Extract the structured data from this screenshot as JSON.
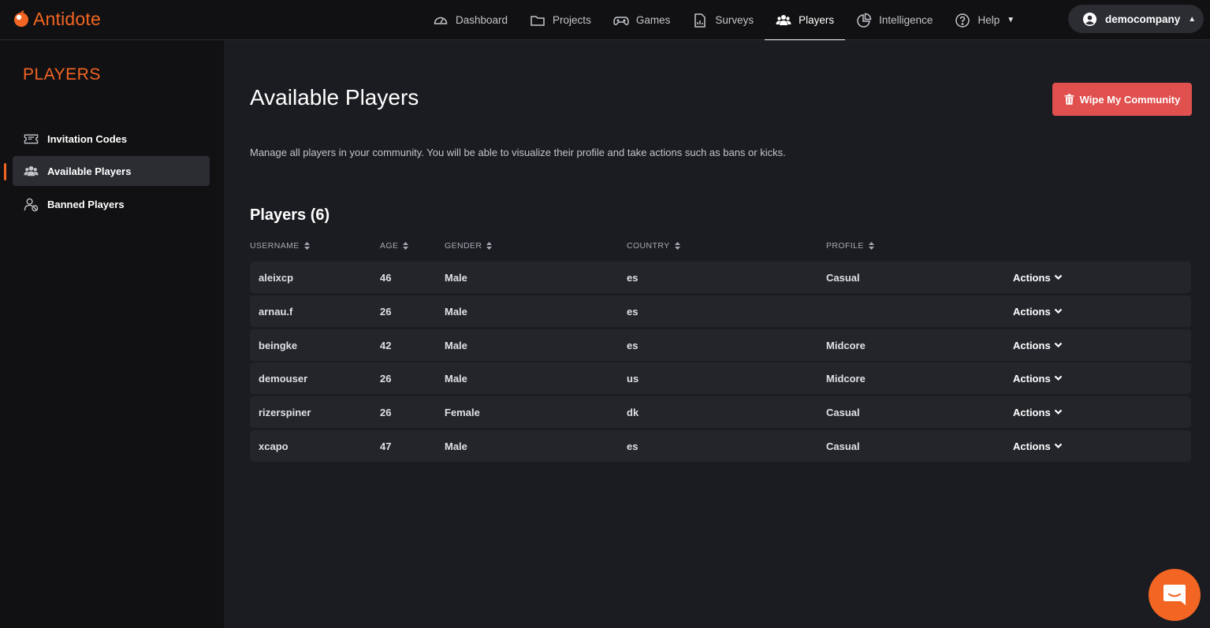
{
  "brand": {
    "name": "Antidote",
    "accent": "#f26522"
  },
  "nav": {
    "items": [
      {
        "label": "Dashboard",
        "icon": "gauge-icon"
      },
      {
        "label": "Projects",
        "icon": "folder-icon"
      },
      {
        "label": "Games",
        "icon": "gamepad-icon"
      },
      {
        "label": "Surveys",
        "icon": "document-chart-icon"
      },
      {
        "label": "Players",
        "icon": "users-icon",
        "active": true
      },
      {
        "label": "Intelligence",
        "icon": "pie-chart-icon"
      },
      {
        "label": "Help",
        "icon": "question-circle-icon"
      }
    ],
    "user": "democompany"
  },
  "sidebar": {
    "title": "PLAYERS",
    "items": [
      {
        "label": "Invitation Codes",
        "icon": "ticket-icon"
      },
      {
        "label": "Available Players",
        "icon": "users-icon",
        "active": true
      },
      {
        "label": "Banned Players",
        "icon": "user-banned-icon"
      }
    ]
  },
  "main": {
    "title": "Available Players",
    "wipe_button": "Wipe My Community",
    "description": "Manage all players in your community. You will be able to visualize their profile and take actions such as bans or kicks.",
    "section_title": "Players (6)",
    "table": {
      "headers": [
        "USERNAME",
        "AGE",
        "GENDER",
        "COUNTRY",
        "PROFILE"
      ],
      "actions_label": "Actions",
      "rows": [
        {
          "username": "aleixcp",
          "age": "46",
          "gender": "Male",
          "country": "es",
          "profile": "Casual"
        },
        {
          "username": "arnau.f",
          "age": "26",
          "gender": "Male",
          "country": "es",
          "profile": ""
        },
        {
          "username": "beingke",
          "age": "42",
          "gender": "Male",
          "country": "es",
          "profile": "Midcore"
        },
        {
          "username": "demouser",
          "age": "26",
          "gender": "Male",
          "country": "us",
          "profile": "Midcore"
        },
        {
          "username": "rizerspiner",
          "age": "26",
          "gender": "Female",
          "country": "dk",
          "profile": "Casual"
        },
        {
          "username": "xcapo",
          "age": "47",
          "gender": "Male",
          "country": "es",
          "profile": "Casual"
        }
      ]
    }
  }
}
